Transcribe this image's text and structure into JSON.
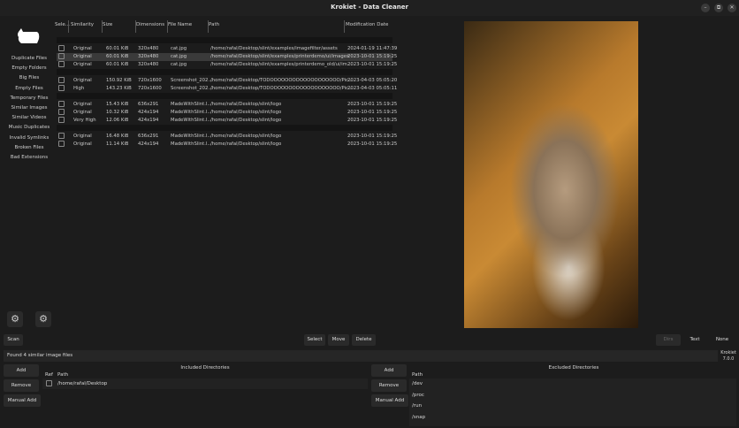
{
  "window": {
    "title": "Krokiet - Data Cleaner",
    "minimize": "–",
    "maximize": "⧉",
    "close": "✕"
  },
  "sidebar": {
    "items": [
      "Duplicate Files",
      "Empty Folders",
      "Big Files",
      "Empty Files",
      "Temporary Files",
      "Similar Images",
      "Similar Videos",
      "Music Duplicates",
      "Invalid Symlinks",
      "Broken Files",
      "Bad Extensions"
    ]
  },
  "table": {
    "headers": [
      "Sele...",
      "Similarity",
      "Size",
      "Dimensions",
      "File Name",
      "Path",
      "Modification Date"
    ],
    "groups": [
      [
        [
          "Original",
          "60.01 KiB",
          "320x480",
          "cat.jpg",
          "/home/rafal/Desktop/slint/examples/imagefilter/assets",
          "2024-01-19 11:47:39"
        ],
        [
          "Original",
          "60.01 KiB",
          "320x480",
          "cat.jpg",
          "/home/rafal/Desktop/slint/examples/printerdemo/ui/images",
          "2023-10-01 15:19:25"
        ],
        [
          "Original",
          "60.01 KiB",
          "320x480",
          "cat.jpg",
          "/home/rafal/Desktop/slint/examples/printerdemo_old/ui/im...",
          "2023-10-01 15:19:25"
        ]
      ],
      [
        [
          "Original",
          "150.92 KiB",
          "720x1600",
          "Screenshot_202...",
          "/home/rafal/Desktop/TODOOOOOOOOOOOOOOOOOOO/Pic...",
          "2023-04-03 05:05:20"
        ],
        [
          "High",
          "143.23 KiB",
          "720x1600",
          "Screenshot_202...",
          "/home/rafal/Desktop/TODOOOOOOOOOOOOOOOOOOO/Pic...",
          "2023-04-03 05:05:11"
        ]
      ],
      [
        [
          "Original",
          "15.43 KiB",
          "636x291",
          "MadeWithSlint.l...",
          "/home/rafal/Desktop/slint/logo",
          "2023-10-01 15:19:25"
        ],
        [
          "Original",
          "10.32 KiB",
          "424x194",
          "MadeWithSlint.l...",
          "/home/rafal/Desktop/slint/logo",
          "2023-10-01 15:19:25"
        ],
        [
          "Very High",
          "12.06 KiB",
          "424x194",
          "MadeWithSlint.l...",
          "/home/rafal/Desktop/slint/logo",
          "2023-10-01 15:19:25"
        ]
      ],
      [
        [
          "Original",
          "16.48 KiB",
          "636x291",
          "MadeWithSlint.l...",
          "/home/rafal/Desktop/slint/logo",
          "2023-10-01 15:19:25"
        ],
        [
          "Original",
          "11.14 KiB",
          "424x194",
          "MadeWithSlint.l...",
          "/home/rafal/Desktop/slint/logo",
          "2023-10-01 15:19:25"
        ]
      ]
    ]
  },
  "actions": {
    "scan": "Scan",
    "select": "Select",
    "move": "Move",
    "delete": "Delete",
    "dirs": "Dirs",
    "text": "Text",
    "none": "None"
  },
  "status": {
    "message": "Found 4 similar image files",
    "app": "Krokiet",
    "version": "7.0.0"
  },
  "included": {
    "title": "Included Directories",
    "add": "Add",
    "remove": "Remove",
    "manual_add": "Manual Add",
    "col_ref": "Ref",
    "col_path": "Path",
    "paths": [
      "/home/rafal/Desktop"
    ]
  },
  "excluded": {
    "title": "Excluded Directories",
    "add": "Add",
    "remove": "Remove",
    "manual_add": "Manual Add",
    "col_path": "Path",
    "paths": [
      "/dev",
      "/proc",
      "/run",
      "/snap"
    ]
  }
}
